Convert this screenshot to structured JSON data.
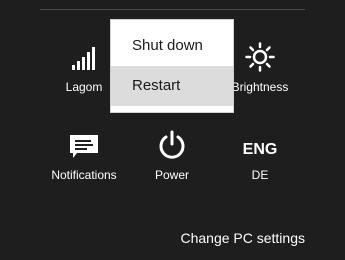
{
  "tiles": {
    "network": {
      "label": "Lagom",
      "icon": "wifi-signal-icon"
    },
    "brightness": {
      "label": "Brightness",
      "icon": "brightness-icon"
    },
    "notifications": {
      "label": "Notifications",
      "icon": "notifications-icon"
    },
    "power": {
      "label": "Power",
      "icon": "power-icon"
    },
    "language": {
      "code": "ENG",
      "label": "DE"
    }
  },
  "power_menu": {
    "items": [
      {
        "label": "Shut down"
      },
      {
        "label": "Restart"
      }
    ],
    "highlighted": "Restart"
  },
  "footer": {
    "change_settings_label": "Change PC settings"
  }
}
